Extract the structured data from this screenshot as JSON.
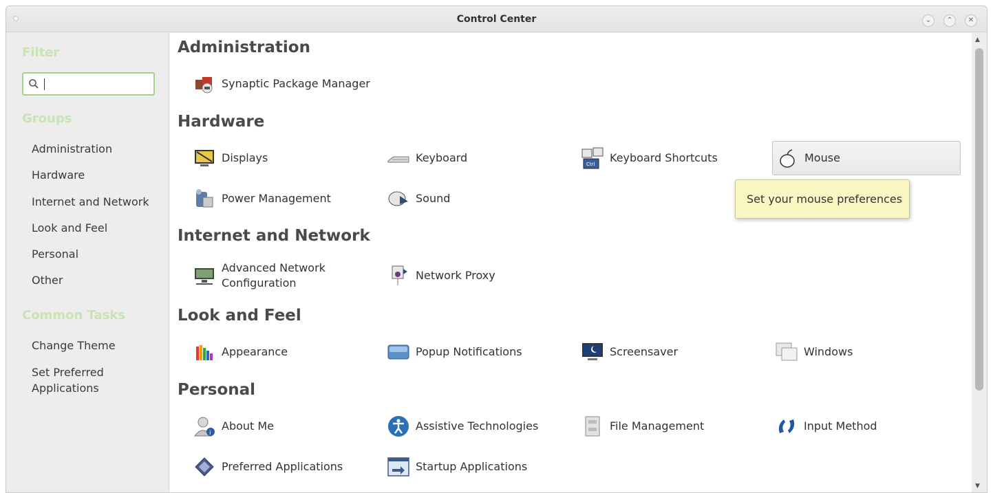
{
  "window": {
    "title": "Control Center"
  },
  "sidebar": {
    "filter_heading": "Filter",
    "search": {
      "value": "",
      "icon": "search-icon"
    },
    "groups_heading": "Groups",
    "groups": [
      "Administration",
      "Hardware",
      "Internet and Network",
      "Look and Feel",
      "Personal",
      "Other"
    ],
    "tasks_heading": "Common Tasks",
    "tasks": [
      "Change Theme",
      "Set Preferred Applications"
    ]
  },
  "content": {
    "groups": [
      {
        "title": "Administration",
        "items": [
          {
            "label": "Synaptic Package Manager",
            "icon": "package-manager-icon"
          }
        ]
      },
      {
        "title": "Hardware",
        "items": [
          {
            "label": "Displays",
            "icon": "display-icon"
          },
          {
            "label": "Keyboard",
            "icon": "keyboard-icon"
          },
          {
            "label": "Keyboard Shortcuts",
            "icon": "keyboard-shortcuts-icon"
          },
          {
            "label": "Mouse",
            "icon": "mouse-icon"
          },
          {
            "label": "Power Management",
            "icon": "power-management-icon"
          },
          {
            "label": "Sound",
            "icon": "sound-icon"
          }
        ]
      },
      {
        "title": "Internet and Network",
        "items": [
          {
            "label": "Advanced Network Configuration",
            "icon": "network-config-icon"
          },
          {
            "label": "Network Proxy",
            "icon": "network-proxy-icon"
          }
        ]
      },
      {
        "title": "Look and Feel",
        "items": [
          {
            "label": "Appearance",
            "icon": "appearance-icon"
          },
          {
            "label": "Popup Notifications",
            "icon": "notifications-icon"
          },
          {
            "label": "Screensaver",
            "icon": "screensaver-icon"
          },
          {
            "label": "Windows",
            "icon": "windows-icon"
          }
        ]
      },
      {
        "title": "Personal",
        "items": [
          {
            "label": "About Me",
            "icon": "about-me-icon"
          },
          {
            "label": "Assistive Technologies",
            "icon": "accessibility-icon"
          },
          {
            "label": "File Management",
            "icon": "file-management-icon"
          },
          {
            "label": "Input Method",
            "icon": "input-method-icon"
          },
          {
            "label": "Preferred Applications",
            "icon": "preferred-apps-icon"
          },
          {
            "label": "Startup Applications",
            "icon": "startup-apps-icon"
          }
        ]
      }
    ]
  },
  "tooltip": {
    "text": "Set your mouse preferences"
  },
  "colors": {
    "accent": "#a6cf8b",
    "heading_green": "#c8e3b4",
    "tooltip_bg": "#f9f8c2"
  }
}
